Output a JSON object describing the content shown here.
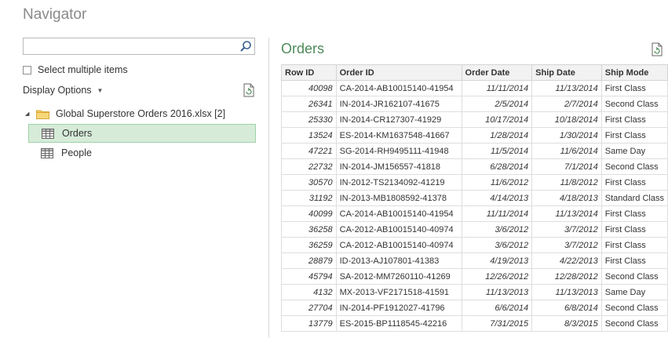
{
  "window": {
    "title": "Navigator"
  },
  "search": {
    "value": "",
    "placeholder": ""
  },
  "select_multiple": {
    "label": "Select multiple items",
    "checked": false
  },
  "display_options": {
    "label": "Display Options"
  },
  "icons": {
    "search": "search-icon",
    "refresh_left": "refresh-document-icon",
    "refresh_right": "refresh-document-icon",
    "folder": "folder-icon",
    "table": "table-icon"
  },
  "tree": {
    "file": {
      "label": "Global Superstore Orders 2016.xlsx [2]",
      "expanded": true
    },
    "items": [
      {
        "label": "Orders",
        "selected": true
      },
      {
        "label": "People",
        "selected": false
      }
    ]
  },
  "preview": {
    "title": "Orders",
    "columns": [
      "Row ID",
      "Order ID",
      "Order Date",
      "Ship Date",
      "Ship Mode"
    ],
    "rows": [
      [
        "40098",
        "CA-2014-AB10015140-41954",
        "11/11/2014",
        "11/13/2014",
        "First Class"
      ],
      [
        "26341",
        "IN-2014-JR162107-41675",
        "2/5/2014",
        "2/7/2014",
        "Second Class"
      ],
      [
        "25330",
        "IN-2014-CR127307-41929",
        "10/17/2014",
        "10/18/2014",
        "First Class"
      ],
      [
        "13524",
        "ES-2014-KM1637548-41667",
        "1/28/2014",
        "1/30/2014",
        "First Class"
      ],
      [
        "47221",
        "SG-2014-RH9495111-41948",
        "11/5/2014",
        "11/6/2014",
        "Same Day"
      ],
      [
        "22732",
        "IN-2014-JM156557-41818",
        "6/28/2014",
        "7/1/2014",
        "Second Class"
      ],
      [
        "30570",
        "IN-2012-TS2134092-41219",
        "11/6/2012",
        "11/8/2012",
        "First Class"
      ],
      [
        "31192",
        "IN-2013-MB1808592-41378",
        "4/14/2013",
        "4/18/2013",
        "Standard Class"
      ],
      [
        "40099",
        "CA-2014-AB10015140-41954",
        "11/11/2014",
        "11/13/2014",
        "First Class"
      ],
      [
        "36258",
        "CA-2012-AB10015140-40974",
        "3/6/2012",
        "3/7/2012",
        "First Class"
      ],
      [
        "36259",
        "CA-2012-AB10015140-40974",
        "3/6/2012",
        "3/7/2012",
        "First Class"
      ],
      [
        "28879",
        "ID-2013-AJ107801-41383",
        "4/19/2013",
        "4/22/2013",
        "First Class"
      ],
      [
        "45794",
        "SA-2012-MM7260110-41269",
        "12/26/2012",
        "12/28/2012",
        "Second Class"
      ],
      [
        "4132",
        "MX-2013-VF2171518-41591",
        "11/13/2013",
        "11/13/2013",
        "Same Day"
      ],
      [
        "27704",
        "IN-2014-PF1912027-41796",
        "6/6/2014",
        "6/8/2014",
        "Second Class"
      ],
      [
        "13779",
        "ES-2015-BP1118545-42216",
        "7/31/2015",
        "8/3/2015",
        "Second Class"
      ]
    ]
  },
  "colors": {
    "title": "#8a8a8a",
    "preview_title": "#4f8a5a",
    "selection_bg": "#d6ecd9",
    "selection_border": "#9fd1a8",
    "header_bg": "#f2f2f2"
  }
}
